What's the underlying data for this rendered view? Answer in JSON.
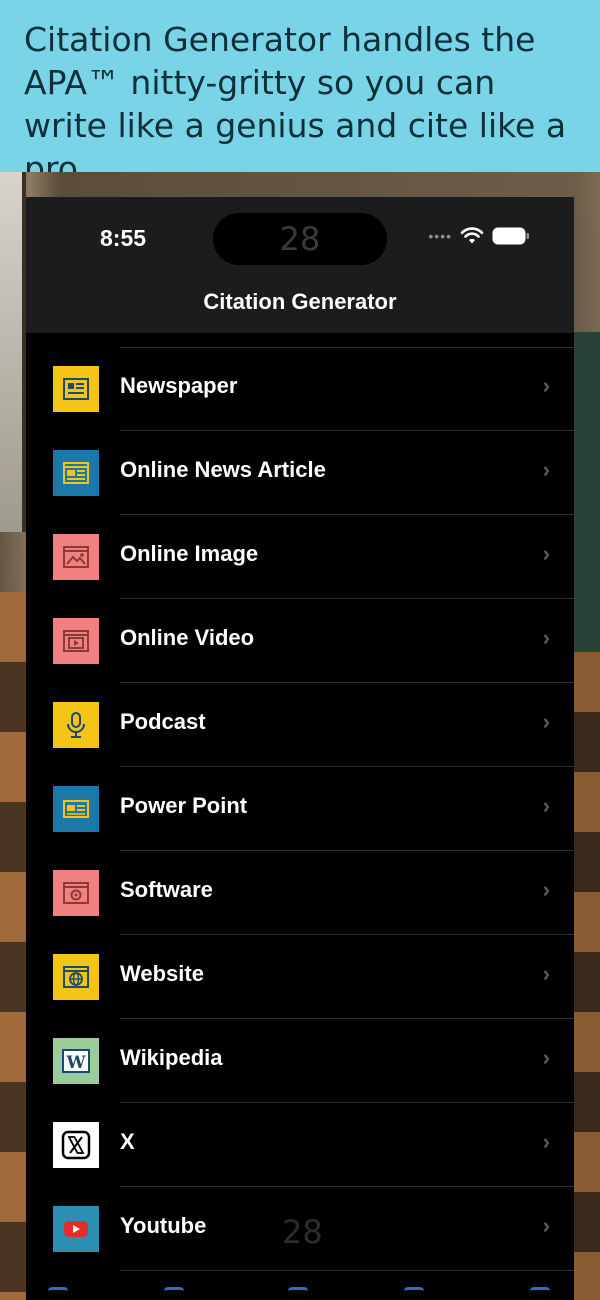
{
  "promo": {
    "text": "Citation Generator handles the APA™ nitty-gritty so you can write like a genius and cite like a pro."
  },
  "status_bar": {
    "time": "8:55",
    "island_label": "28",
    "signal_dots": "••••"
  },
  "nav": {
    "title": "Citation Generator"
  },
  "list": {
    "chevron": "›",
    "items": [
      {
        "label": "Newspaper",
        "icon": "newspaper-icon",
        "bg": "#f4c514",
        "fg": "#1c4a6e"
      },
      {
        "label": "Online News Article",
        "icon": "news-article-icon",
        "bg": "#1b78a8",
        "fg": "#f4c514"
      },
      {
        "label": "Online Image",
        "icon": "image-icon",
        "bg": "#f28080",
        "fg": "#8b3a3a"
      },
      {
        "label": "Online Video",
        "icon": "video-icon",
        "bg": "#f28080",
        "fg": "#8b3a3a"
      },
      {
        "label": "Podcast",
        "icon": "microphone-icon",
        "bg": "#f4c514",
        "fg": "#1c4a6e"
      },
      {
        "label": "Power Point",
        "icon": "presentation-icon",
        "bg": "#1b78a8",
        "fg": "#f4c514"
      },
      {
        "label": "Software",
        "icon": "gear-window-icon",
        "bg": "#f28080",
        "fg": "#8b3a3a"
      },
      {
        "label": "Website",
        "icon": "globe-window-icon",
        "bg": "#f4c514",
        "fg": "#1c4a6e"
      },
      {
        "label": "Wikipedia",
        "icon": "wikipedia-icon",
        "bg": "#9ccc9c",
        "fg": "#1c4a6e"
      },
      {
        "label": "X",
        "icon": "x-logo-icon",
        "bg": "#ffffff",
        "fg": "#000000"
      },
      {
        "label": "Youtube",
        "icon": "youtube-icon",
        "bg": "#2a8fb0",
        "fg": "#e52d27"
      }
    ]
  },
  "overlay_label": "28",
  "colors": {
    "accent": "#2f6ecb",
    "promo_bg": "#78d4e6",
    "nav_bg": "#1c1c1e",
    "list_bg": "#000000"
  }
}
